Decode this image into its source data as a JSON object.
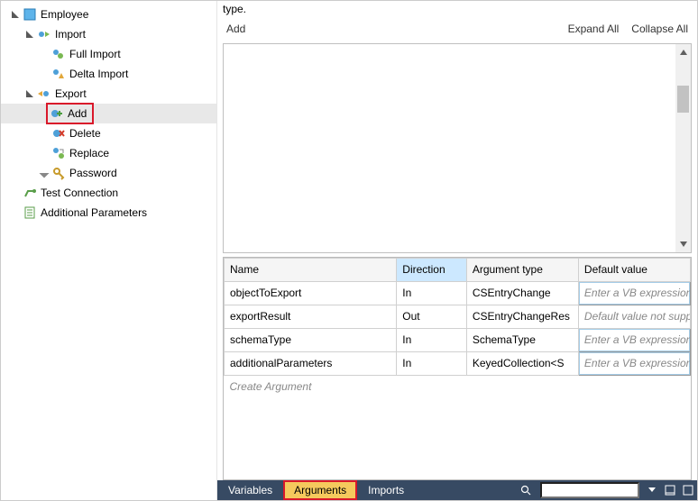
{
  "top_text": "type.",
  "actions": {
    "add": "Add",
    "expand": "Expand All",
    "collapse": "Collapse All"
  },
  "tree": {
    "employee": "Employee",
    "import": "Import",
    "full_import": "Full Import",
    "delta_import": "Delta Import",
    "export": "Export",
    "add": "Add",
    "delete": "Delete",
    "replace": "Replace",
    "password": "Password",
    "test_conn": "Test Connection",
    "addl_params": "Additional Parameters"
  },
  "table": {
    "headers": {
      "name": "Name",
      "direction": "Direction",
      "argtype": "Argument type",
      "default": "Default value"
    },
    "rows": [
      {
        "name": "objectToExport",
        "direction": "In",
        "argtype": "CSEntryChange",
        "default": "Enter a VB expression",
        "ph": true
      },
      {
        "name": "exportResult",
        "direction": "Out",
        "argtype": "CSEntryChangeRes",
        "default": "Default value not suppor",
        "ph": true
      },
      {
        "name": "schemaType",
        "direction": "In",
        "argtype": "SchemaType",
        "default": "Enter a VB expression",
        "ph": true
      },
      {
        "name": "additionalParameters",
        "direction": "In",
        "argtype": "KeyedCollection<S",
        "default": "Enter a VB expression",
        "ph": true
      }
    ],
    "create": "Create Argument"
  },
  "tabs": {
    "variables": "Variables",
    "arguments": "Arguments",
    "imports": "Imports"
  },
  "colors": {
    "highlight_red": "#d9182a",
    "tab_active": "#f5c95d",
    "bottom_bar": "#374a63",
    "sorted_header": "#cce8ff"
  }
}
